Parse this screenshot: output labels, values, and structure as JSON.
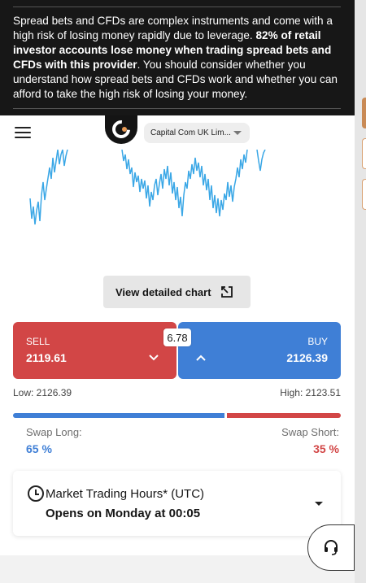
{
  "risk_warning": {
    "text_before": "Spread bets and CFDs are complex instruments and come with a high risk of losing money rapidly due to leverage. ",
    "text_bold": "82% of retail investor accounts lose money when trading spread bets and CFDs with this provider",
    "text_after": ". You should consider whether you understand how spread bets and CFDs work and whether you can afford to take the high risk of losing your money."
  },
  "header": {
    "entity_selector": "Capital Com UK Lim..."
  },
  "chart": {
    "detail_button_label": "View detailed chart",
    "line_color": "#3aa7e6"
  },
  "trade": {
    "sell_label": "SELL",
    "sell_price": "2119.61",
    "buy_label": "BUY",
    "buy_price": "2126.39",
    "spread": "6.78",
    "low_text": "Low: 2126.39",
    "high_text": "High: 2123.51",
    "sentiment_buy_fraction": 0.65,
    "sentiment_sell_fraction": 0.35,
    "swap_long_label": "Swap Long:",
    "swap_long_value": "65 %",
    "swap_short_label": "Swap Short:",
    "swap_short_value": "35 %",
    "sell_color": "#d24646",
    "buy_color": "#3f7fd6"
  },
  "trading_hours": {
    "title": "Market Trading Hours* (UTC)",
    "status": "Opens on Monday at 00:05"
  }
}
